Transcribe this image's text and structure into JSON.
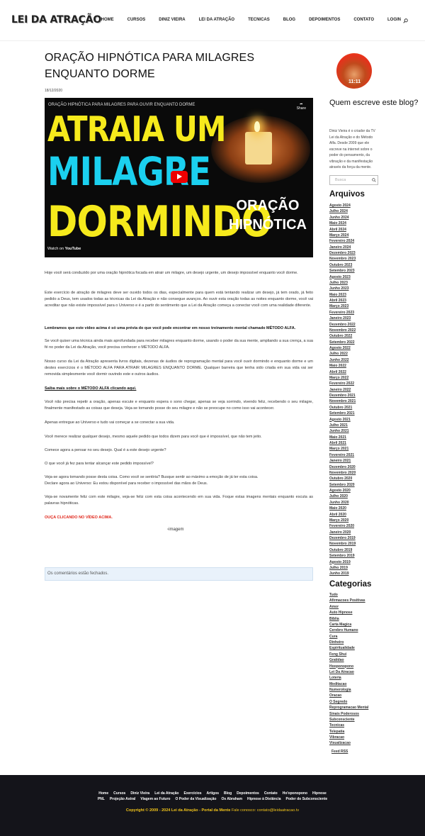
{
  "header": {
    "logo": "LEI DA ATRAÇÃO",
    "nav": [
      "HOME",
      "CURSOS",
      "DINIZ VIEIRA",
      "LEI DA ATRAÇÃO",
      "TECNICAS",
      "BLOG",
      "DEPOIMENTOS",
      "CONTATO",
      "LOGIN"
    ],
    "search_icon": "search-icon"
  },
  "post": {
    "title": "ORAÇÃO HIPNÓTICA PARA MILAGRES ENQUANTO DORME",
    "date": "18/12/2020",
    "video": {
      "title": "ORAÇÃO HIPNÓTICA PARA MILAGRES PARA OUVIR ENQUANTO DORME",
      "share": "Share",
      "line1": "ATRAIA UM",
      "line2": "MILAGRE",
      "line3": "DORMINDO",
      "badge1": "ORAÇÃO",
      "badge2": "HIPNÓTICA",
      "watch": "Watch on",
      "youtube": "YouTube"
    },
    "paragraphs": [
      "Hoje você será conduzido por uma oração hipnótica focada em atrair um milagre, um desejo urgente, um desejo impossível enquanto você dorme.",
      "Este exercício de atração de milagres deve ser ouvido todos os dias, especialmente para quem está tentando realizar um desejo, já tem orado, já feito pedido a Deus, tem usados todas as técnicas da Lei da Atração e não consegue avanços. Ao ouvir esta oração todas as noites enquanto dorme, você vai acreditar que não existe impossível para o Universo e é a partir do sentimento que a Lei da Atração começa a conectar você com uma realidade diferente.",
      "Lembramos que este vídeo acima é só uma prévia do que você pode encontrar em nosso treinamento mental chamado MÉTODO ALFA.",
      "Se você quiser uma técnica ainda mais aprofundada para receber milagres enquanto dorme, usando o poder da sua mente, ampliando a sua crença, a sua fé no poder da Lei da Atração, você precisa conhecer o MÉTODO ALFA.",
      "Nosso curso da Lei da Atração apresenta livros digitais, dezenas de áudios de reprogramação mental para você ouvir dormindo e enquanto dorme e um destes exercícios é o MÉTODO ALFA PARA ATRAIR MILAGRES ENQUANTO DORME. Qualquer barreira que tenha sido criada em sua vida vai ser removida simplesmente você dormir ouvindo este e outros áudios.",
      "Saiba mais sobre o MÉTODO ALFA clicando aqui.",
      "Você não precisa repetir a oração, apenas escute e enquanto espera o sono chegar, apenas se veja sorrindo, vivendo feliz, recebendo o seu milagre, finalmente manifestado as coisas que deseja. Veja-se tomando posse do seu milagre e não se preocupe no como isso vai acontecer.",
      "Apenas entregue ao Universo e tudo vai começar a se conectar a sua vida.",
      "Você merece realizar qualquer desejo, mesmo aquele pedido que todos dizem para você que é impossível, que não tem jeito.",
      "Comece agora a pensar no seu desejo. Qual é a este desejo urgente?",
      "O que você já fez para tentar alcançar este pedido impossível?",
      "Veja-se agora tomando posse desta coisa. Como você se sentiria? Busque sentir ao máximo a emoção de já ter esta coisa.",
      "Declare agora ao Universo: Eu estou disponível para receber o impossível das mãos de Deus.",
      "Veja-se novamente feliz com este milagre, veja-se feliz com esta coisa acontecendo em sua vida. Foque estas imagens mentais enquanto escuta as palavras hipnóticas.",
      "OUÇA CLICANDO NO VÍDEO ACIMA."
    ],
    "image_alt": "imagem",
    "comments": "Os comentários estão fechados."
  },
  "sidebar": {
    "quem": "Quem escreve este blog?",
    "bio": "Diniz Vieira é o criador da TV Lei da Atração e do Método Alfa. Desde 2009 que ele escreve na internet sobre o poder do pensamento, da vibração e da manifestação através da força da mente.",
    "search_placeholder": "Busca",
    "archives_title": "Arquivos",
    "archives": [
      "Agosto 2024",
      "Julho 2024",
      "Junho 2024",
      "Maio 2024",
      "Abril 2024",
      "Março 2024",
      "Fevereiro 2024",
      "Janeiro 2024",
      "Dezembro 2023",
      "Novembro 2023",
      "Outubro 2023",
      "Setembro 2023",
      "Agosto 2023",
      "Julho 2023",
      "Junho 2023",
      "Maio 2023",
      "Abril 2023",
      "Março 2023",
      "Fevereiro 2023",
      "Janeiro 2023",
      "Dezembro 2022",
      "Novembro 2022",
      "Outubro 2022",
      "Setembro 2022",
      "Agosto 2022",
      "Julho 2022",
      "Junho 2022",
      "Maio 2022",
      "Abril 2022",
      "Março 2022",
      "Fevereiro 2022",
      "Janeiro 2022",
      "Dezembro 2021",
      "Novembro 2021",
      "Outubro 2021",
      "Setembro 2021",
      "Agosto 2021",
      "Julho 2021",
      "Junho 2021",
      "Maio 2021",
      "Abril 2021",
      "Março 2021",
      "Fevereiro 2021",
      "Janeiro 2021",
      "Dezembro 2020",
      "Novembro 2020",
      "Outubro 2020",
      "Setembro 2020",
      "Agosto 2020",
      "Julho 2020",
      "Junho 2020",
      "Maio 2020",
      "Abril 2020",
      "Março 2020",
      "Fevereiro 2020",
      "Janeiro 2020",
      "Dezembro 2019",
      "Novembro 2019",
      "Outubro 2019",
      "Setembro 2019",
      "Agosto 2019",
      "Julho 2019",
      "Junho 2019"
    ],
    "categories_title": "Categorias",
    "categories": [
      "Tudo",
      "Afirmacoes Positivas",
      "Amor",
      "Auto Hipnose",
      "Bíblia",
      "Carta Magica",
      "Cerebro Humano",
      "Cura",
      "Dinheiro",
      "Espiritualidade",
      "Feng Shui",
      "Gratidao",
      "Hooponopono",
      "Lei Da Atracao",
      "Loteria",
      "Meditacao",
      "Numerologia",
      "Oracao",
      "O Segredo",
      "Reprogramacao Mental",
      "Sinais Poderosos",
      "Subconsciente",
      "Tecnicas",
      "Telepatia",
      "Vibracao",
      "Visualizacao"
    ],
    "feed": "Feed RSS"
  },
  "footer": {
    "row1": [
      "Home",
      "Cursos",
      "Diniz Vieira",
      "Lei da Atração",
      "Exercícios",
      "Artigos",
      "Blog",
      "Depoimentos",
      "Contato",
      "Ho'oponopono",
      "Hipnose"
    ],
    "row2": [
      "PNL",
      "Projeção Astral",
      "Viagem ao Futuro",
      "O Poder da Visualização",
      "Os Abraham",
      "Hipnose à Distância",
      "Poder do Subconsciente"
    ],
    "copy": "Copyright © 2009 - 2024 Lei da Atração - Portal da Mente",
    "contact": "Fale conosco: contato@leidaatracao.tv"
  },
  "colors": {
    "accent_red": "#e0261a",
    "footer_bg": "#14141a",
    "copyright": "#f2c41a"
  }
}
